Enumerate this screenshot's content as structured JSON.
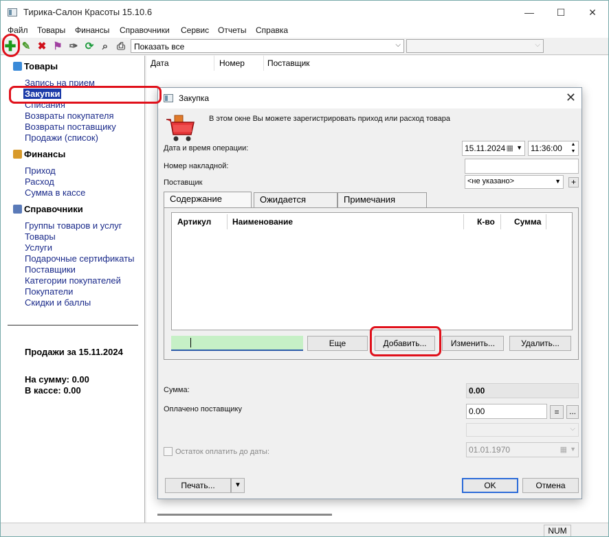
{
  "app": {
    "title": "Тирика-Салон Красоты 15.10.6"
  },
  "menu": [
    "Файл",
    "Товары",
    "Финансы",
    "Справочники",
    "Сервис",
    "Отчеты",
    "Справка"
  ],
  "toolbar": {
    "filter_value": "Показать все"
  },
  "sidebar": {
    "goods": {
      "title": "Товары",
      "items": [
        "Запись на прием",
        "Закупки",
        "Списания",
        "Возвраты покупателя",
        "Возвраты поставщику",
        "Продажи (список)"
      ]
    },
    "finance": {
      "title": "Финансы",
      "items": [
        "Приход",
        "Расход",
        "Сумма в кассе"
      ]
    },
    "refs": {
      "title": "Справочники",
      "items": [
        "Группы товаров и услуг",
        "Товары",
        "Услуги",
        "Подарочные сертификаты",
        "Поставщики",
        "Категории покупателей",
        "Покупатели",
        "Скидки и баллы"
      ]
    },
    "sales_title": "Продажи за 15.11.2024",
    "sum_line": "На сумму: 0.00",
    "cash_line": "В кассе: 0.00"
  },
  "list": {
    "columns": [
      "Дата",
      "Номер",
      "Поставщик"
    ]
  },
  "dialog": {
    "title": "Закупка",
    "intro": "В этом окне Вы можете зарегистрировать приход или расход товара",
    "date_label": "Дата и время операции:",
    "date_value": "15.11.2024",
    "time_value": "11:36:00",
    "invoice_label": "Номер накладной:",
    "invoice_value": "",
    "supplier_label": "Поставщик",
    "supplier_value": "<не указано>",
    "tabs": [
      "Содержание",
      "Ожидается",
      "Примечания"
    ],
    "grid_columns": [
      "Артикул",
      "Наименование",
      "К-во",
      "Сумма"
    ],
    "btn_more": "Еще",
    "btn_add": "Добавить...",
    "btn_edit": "Изменить...",
    "btn_delete": "Удалить...",
    "sum_label": "Сумма:",
    "sum_value": "0.00",
    "paid_label": "Оплачено поставщику",
    "paid_value": "0.00",
    "eq_symbol": "=",
    "ellipsis": "...",
    "remainder_label": "Остаток оплатить до даты:",
    "remainder_date": "01.01.1970",
    "btn_print": "Печать...",
    "btn_ok": "OK",
    "btn_cancel": "Отмена"
  },
  "status": {
    "num": "NUM"
  },
  "colors": {
    "annotation": "#e0101a",
    "active_nav": "#1a3aa8",
    "green_field": "#c6f0c6"
  }
}
